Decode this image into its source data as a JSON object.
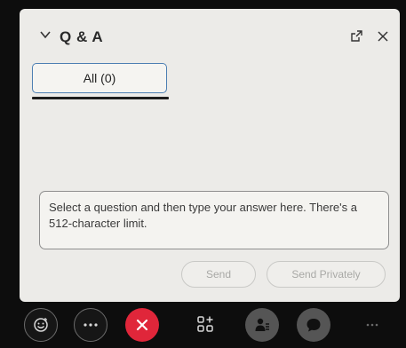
{
  "panel": {
    "title": "Q & A",
    "icons": {
      "collapse": "chevron-down-icon",
      "popout": "popout-icon",
      "close": "close-icon"
    }
  },
  "tabs": [
    {
      "label": "All (0)",
      "selected": true
    }
  ],
  "answer_input": {
    "placeholder": "Select a question and then type your answer here. There's a 512-character limit.",
    "value": ""
  },
  "buttons": {
    "send": "Send",
    "send_privately": "Send Privately"
  },
  "toolbar": {
    "items": [
      {
        "icon": "reactions-icon"
      },
      {
        "icon": "more-options-icon"
      },
      {
        "icon": "end-call-icon"
      },
      {
        "icon": "apps-icon"
      },
      {
        "icon": "participants-icon"
      },
      {
        "icon": "chat-icon"
      },
      {
        "icon": "overflow-icon"
      }
    ]
  },
  "colors": {
    "panel_bg": "#ecebe8",
    "window_bg": "#0d0d0d",
    "tab_border": "#4d7fb3",
    "end_call": "#e0263a"
  }
}
